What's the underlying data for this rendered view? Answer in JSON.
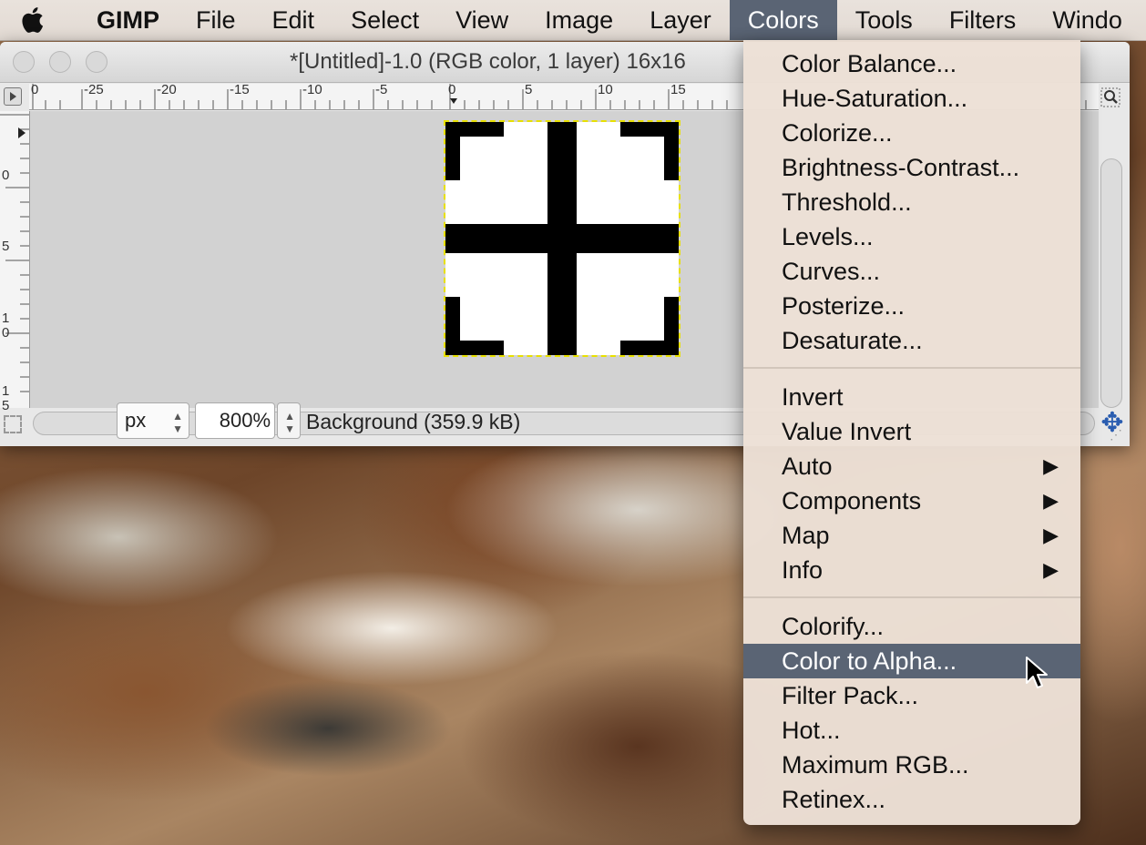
{
  "menubar": {
    "app_name": "GIMP",
    "items": [
      "File",
      "Edit",
      "Select",
      "View",
      "Image",
      "Layer",
      "Colors",
      "Tools",
      "Filters",
      "Windo"
    ],
    "active_item": "Colors",
    "active_color": "#5a6474"
  },
  "window": {
    "title": "*[Untitled]-1.0 (RGB color, 1 layer) 16x16",
    "ruler_h_labels": [
      "0",
      "-25",
      "-20",
      "-15",
      "-10",
      "-5",
      "0",
      "5",
      "10",
      "15"
    ],
    "ruler_v_labels": [
      "0",
      "5",
      "1\n0",
      "1\n5"
    ],
    "unit": "px",
    "zoom_value": "800",
    "zoom_unit": "%",
    "layer_status": "Background (359.9 kB)",
    "selection_color": "#e8e000"
  },
  "colors_menu": {
    "group1": [
      "Color Balance...",
      "Hue-Saturation...",
      "Colorize...",
      "Brightness-Contrast...",
      "Threshold...",
      "Levels...",
      "Curves...",
      "Posterize...",
      "Desaturate..."
    ],
    "group2": [
      "Invert",
      "Value Invert",
      "Auto",
      "Components",
      "Map",
      "Info"
    ],
    "group2_submenus": [
      "Auto",
      "Components",
      "Map",
      "Info"
    ],
    "group3": [
      "Colorify...",
      "Color to Alpha...",
      "Filter Pack...",
      "Hot...",
      "Maximum RGB...",
      "Retinex..."
    ],
    "highlighted": "Color to Alpha...",
    "highlight_color": "#5a6474"
  },
  "icons": {
    "apple": "apple-logo-icon",
    "navigate": "move-cross-icon",
    "zoom": "zoom-icon",
    "submenu": "triangle-right-icon",
    "cursor": "arrow-cursor-icon"
  }
}
